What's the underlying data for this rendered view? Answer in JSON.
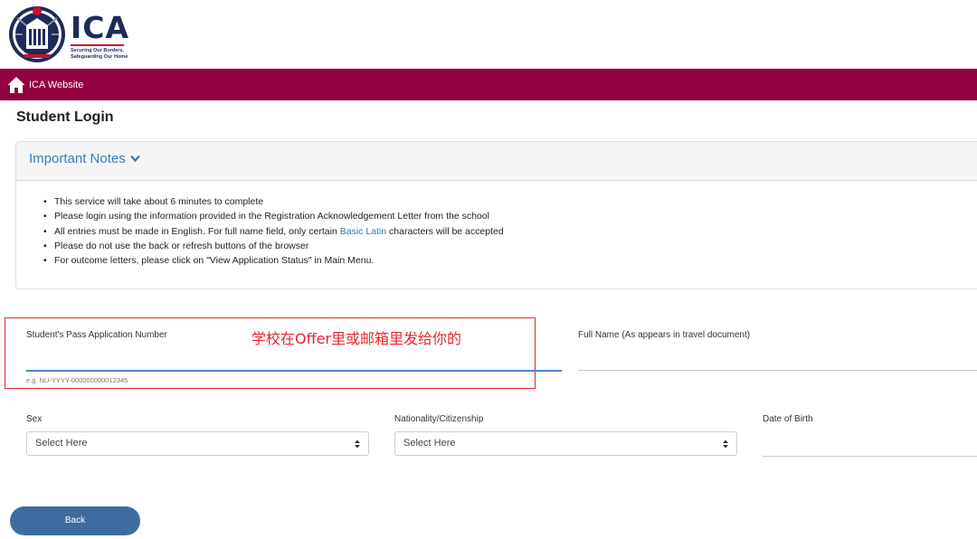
{
  "header": {
    "logo_title": "ICA",
    "logo_tagline_1": "Securing Our Borders,",
    "logo_tagline_2": "Safeguarding Our Home"
  },
  "nav": {
    "home_link": "ICA Website"
  },
  "page_title": "Student Login",
  "notes": {
    "title": "Important Notes",
    "items": [
      "This service will take about 6 minutes to complete",
      "Please login using the information provided in the Registration Acknowledgement Letter from the school",
      "Please do not use the back or refresh buttons of the browser",
      "For outcome letters, please click on \"View Application Status\" in Main Menu."
    ],
    "entries_item": {
      "before": "All entries must be made in English. For full name field, only certain ",
      "link": "Basic Latin",
      "after": " characters will be accepted"
    }
  },
  "annotation": "学校在Offer里或邮箱里发给你的",
  "form": {
    "pass_label": "Student's Pass Application Number",
    "pass_hint": "e.g. NU-YYYY-000000000012345",
    "fullname_label": "Full Name (As appears in travel document)",
    "sex_label": "Sex",
    "sex_value": "Select Here",
    "nationality_label": "Nationality/Citizenship",
    "nationality_value": "Select Here",
    "dob_label": "Date of Birth"
  },
  "back_button": "Back",
  "colors": {
    "brand": "#93003f",
    "link": "#3d7db3",
    "button": "#3e6b9f",
    "annotation": "#e8252b"
  }
}
